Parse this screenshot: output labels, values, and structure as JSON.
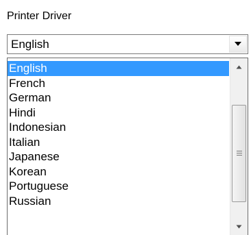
{
  "group_label": "Printer Driver",
  "combo": {
    "selected": "English",
    "button_icon": "chevron-down-icon"
  },
  "dropdown": {
    "items": [
      {
        "label": "English",
        "selected": true
      },
      {
        "label": "French"
      },
      {
        "label": "German"
      },
      {
        "label": "Hindi"
      },
      {
        "label": "Indonesian"
      },
      {
        "label": "Italian"
      },
      {
        "label": "Japanese"
      },
      {
        "label": "Korean"
      },
      {
        "label": "Portuguese"
      },
      {
        "label": "Russian"
      }
    ],
    "scrollbar": {
      "up_icon": "scroll-up-icon",
      "down_icon": "scroll-down-icon"
    }
  },
  "colors": {
    "selection": "#3399ff",
    "selection_text": "#ffffff"
  }
}
